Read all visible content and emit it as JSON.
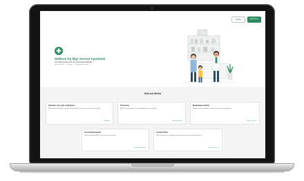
{
  "header": {
    "login_label": "Inloggen",
    "register_label": "Registreren"
  },
  "hero": {
    "logo_glyph": "✚",
    "title": "Welkom bij Mijn Servad Apotheek",
    "subtitle": "Uw online service van uw vertrouwde apotheker",
    "links": [
      "Hoe werkt het?",
      "Privacy",
      "Veelgestelde vragen"
    ]
  },
  "services": {
    "title": "Kies uw dienst",
    "cards": [
      {
        "title": "Herhalen van mijn medicijnen",
        "text": "Met een paar kliks bestelt u uw herhaalmedicijnen en haalt u ze op wanneer het u uitkomt.",
        "link": "Bestellen"
      },
      {
        "title": "Promoties",
        "text": "Bekijk de actuele promoties en aanbiedingen van uw apotheek.",
        "link": "Bekijk promoties"
      },
      {
        "title": "Medicatieoverzicht",
        "text": "Bekijk uw actuele medicatie en de historie van uw medicijngebruik.",
        "link": "Bekijk overzicht"
      },
      {
        "title": "Gezondheidsmeter",
        "text": "Houd uw gezondheid bij en krijg inzicht in uw metingen.",
        "link": "Bekijk gezondheid"
      },
      {
        "title": "Contact/Chat",
        "text": "Stel een vraag aan uw apotheek of chat direct met een van onze medewerkers.",
        "link": "Neem contact op"
      }
    ]
  },
  "colors": {
    "brand": "#2f8a5f",
    "section_bg": "#f3f4f4"
  }
}
